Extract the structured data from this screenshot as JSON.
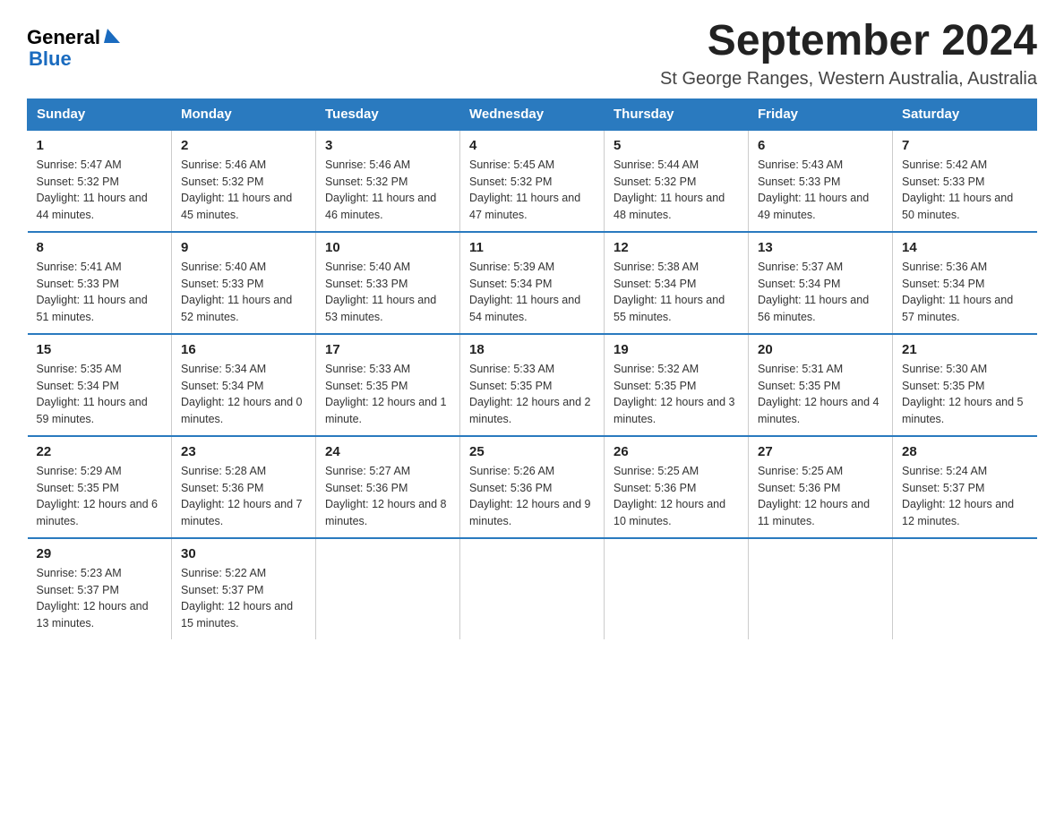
{
  "logo": {
    "general": "General",
    "blue": "Blue"
  },
  "title": "September 2024",
  "subtitle": "St George Ranges, Western Australia, Australia",
  "days_of_week": [
    "Sunday",
    "Monday",
    "Tuesday",
    "Wednesday",
    "Thursday",
    "Friday",
    "Saturday"
  ],
  "weeks": [
    [
      {
        "day": "1",
        "sunrise": "5:47 AM",
        "sunset": "5:32 PM",
        "daylight": "11 hours and 44 minutes."
      },
      {
        "day": "2",
        "sunrise": "5:46 AM",
        "sunset": "5:32 PM",
        "daylight": "11 hours and 45 minutes."
      },
      {
        "day": "3",
        "sunrise": "5:46 AM",
        "sunset": "5:32 PM",
        "daylight": "11 hours and 46 minutes."
      },
      {
        "day": "4",
        "sunrise": "5:45 AM",
        "sunset": "5:32 PM",
        "daylight": "11 hours and 47 minutes."
      },
      {
        "day": "5",
        "sunrise": "5:44 AM",
        "sunset": "5:32 PM",
        "daylight": "11 hours and 48 minutes."
      },
      {
        "day": "6",
        "sunrise": "5:43 AM",
        "sunset": "5:33 PM",
        "daylight": "11 hours and 49 minutes."
      },
      {
        "day": "7",
        "sunrise": "5:42 AM",
        "sunset": "5:33 PM",
        "daylight": "11 hours and 50 minutes."
      }
    ],
    [
      {
        "day": "8",
        "sunrise": "5:41 AM",
        "sunset": "5:33 PM",
        "daylight": "11 hours and 51 minutes."
      },
      {
        "day": "9",
        "sunrise": "5:40 AM",
        "sunset": "5:33 PM",
        "daylight": "11 hours and 52 minutes."
      },
      {
        "day": "10",
        "sunrise": "5:40 AM",
        "sunset": "5:33 PM",
        "daylight": "11 hours and 53 minutes."
      },
      {
        "day": "11",
        "sunrise": "5:39 AM",
        "sunset": "5:34 PM",
        "daylight": "11 hours and 54 minutes."
      },
      {
        "day": "12",
        "sunrise": "5:38 AM",
        "sunset": "5:34 PM",
        "daylight": "11 hours and 55 minutes."
      },
      {
        "day": "13",
        "sunrise": "5:37 AM",
        "sunset": "5:34 PM",
        "daylight": "11 hours and 56 minutes."
      },
      {
        "day": "14",
        "sunrise": "5:36 AM",
        "sunset": "5:34 PM",
        "daylight": "11 hours and 57 minutes."
      }
    ],
    [
      {
        "day": "15",
        "sunrise": "5:35 AM",
        "sunset": "5:34 PM",
        "daylight": "11 hours and 59 minutes."
      },
      {
        "day": "16",
        "sunrise": "5:34 AM",
        "sunset": "5:34 PM",
        "daylight": "12 hours and 0 minutes."
      },
      {
        "day": "17",
        "sunrise": "5:33 AM",
        "sunset": "5:35 PM",
        "daylight": "12 hours and 1 minute."
      },
      {
        "day": "18",
        "sunrise": "5:33 AM",
        "sunset": "5:35 PM",
        "daylight": "12 hours and 2 minutes."
      },
      {
        "day": "19",
        "sunrise": "5:32 AM",
        "sunset": "5:35 PM",
        "daylight": "12 hours and 3 minutes."
      },
      {
        "day": "20",
        "sunrise": "5:31 AM",
        "sunset": "5:35 PM",
        "daylight": "12 hours and 4 minutes."
      },
      {
        "day": "21",
        "sunrise": "5:30 AM",
        "sunset": "5:35 PM",
        "daylight": "12 hours and 5 minutes."
      }
    ],
    [
      {
        "day": "22",
        "sunrise": "5:29 AM",
        "sunset": "5:35 PM",
        "daylight": "12 hours and 6 minutes."
      },
      {
        "day": "23",
        "sunrise": "5:28 AM",
        "sunset": "5:36 PM",
        "daylight": "12 hours and 7 minutes."
      },
      {
        "day": "24",
        "sunrise": "5:27 AM",
        "sunset": "5:36 PM",
        "daylight": "12 hours and 8 minutes."
      },
      {
        "day": "25",
        "sunrise": "5:26 AM",
        "sunset": "5:36 PM",
        "daylight": "12 hours and 9 minutes."
      },
      {
        "day": "26",
        "sunrise": "5:25 AM",
        "sunset": "5:36 PM",
        "daylight": "12 hours and 10 minutes."
      },
      {
        "day": "27",
        "sunrise": "5:25 AM",
        "sunset": "5:36 PM",
        "daylight": "12 hours and 11 minutes."
      },
      {
        "day": "28",
        "sunrise": "5:24 AM",
        "sunset": "5:37 PM",
        "daylight": "12 hours and 12 minutes."
      }
    ],
    [
      {
        "day": "29",
        "sunrise": "5:23 AM",
        "sunset": "5:37 PM",
        "daylight": "12 hours and 13 minutes."
      },
      {
        "day": "30",
        "sunrise": "5:22 AM",
        "sunset": "5:37 PM",
        "daylight": "12 hours and 15 minutes."
      },
      null,
      null,
      null,
      null,
      null
    ]
  ],
  "labels": {
    "sunrise": "Sunrise:",
    "sunset": "Sunset:",
    "daylight": "Daylight:"
  }
}
